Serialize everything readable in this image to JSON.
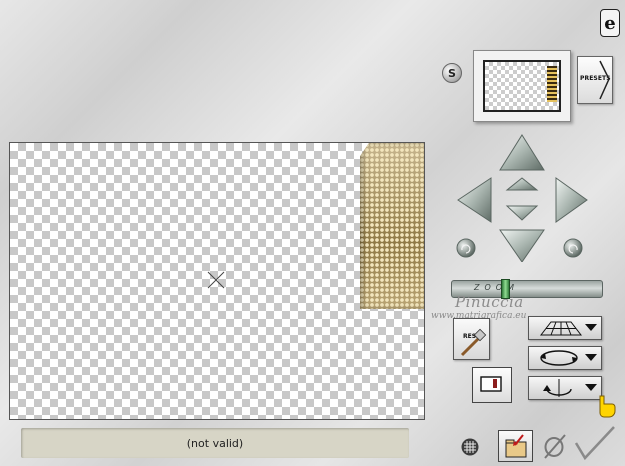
{
  "status": {
    "text": "(not valid)"
  },
  "thumbnail": {
    "presets_label": "PRESETS",
    "s_label": "S"
  },
  "zoom": {
    "label": "ZOOM",
    "level": 0.35
  },
  "reset": {
    "label": "RESET"
  },
  "watermark": {
    "name": "Pinuccia",
    "url": "www.matrigrafica.eu"
  },
  "icons": {
    "logo": "e-logo-icon",
    "crosshair": "crosshair-icon",
    "nav": [
      "arrow-up-icon",
      "arrow-down-icon",
      "arrow-left-icon",
      "arrow-right-icon",
      "zoom-in-icon",
      "zoom-out-icon",
      "rotate-left-icon",
      "rotate-right-icon"
    ],
    "dropdowns": [
      "perspective-grid-icon",
      "rotate-circle-icon",
      "flip-icon"
    ],
    "bottom": [
      "grid-icon",
      "folder-open-icon",
      "cancel-icon",
      "ok-check-icon"
    ],
    "hand": "pointing-hand-icon"
  },
  "colors": {
    "accent": "#2f7a3a",
    "pattern": "#a98f52"
  }
}
